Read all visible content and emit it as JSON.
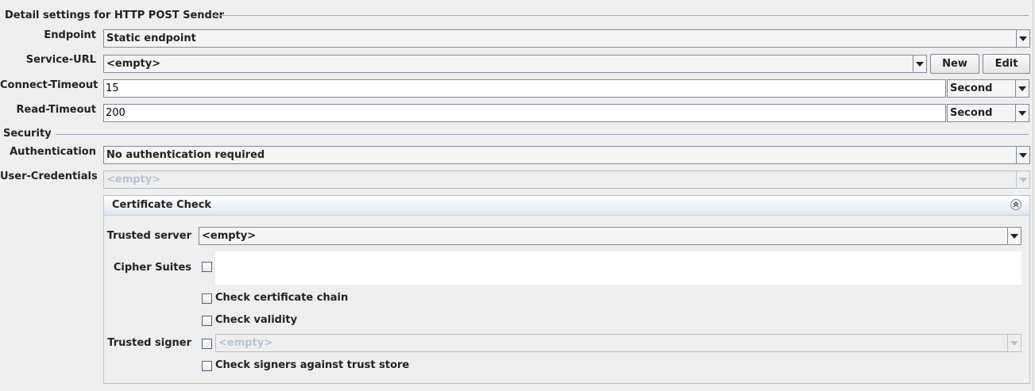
{
  "detail_section": {
    "title": "Detail settings for HTTP POST Sender",
    "endpoint": {
      "label": "Endpoint",
      "value": "Static endpoint"
    },
    "service_url": {
      "label": "Service-URL",
      "value": "<empty>",
      "new_label": "New",
      "edit_label": "Edit"
    },
    "connect_timeout": {
      "label": "Connect-Timeout",
      "value": "15",
      "unit": "Second"
    },
    "read_timeout": {
      "label": "Read-Timeout",
      "value": "200",
      "unit": "Second"
    }
  },
  "security_section": {
    "title": "Security",
    "authentication": {
      "label": "Authentication",
      "value": "No authentication required"
    },
    "user_credentials": {
      "label": "User-Credentials",
      "value": "<empty>"
    }
  },
  "certificate_check": {
    "title": "Certificate Check",
    "trusted_server": {
      "label": "Trusted server",
      "value": "<empty>"
    },
    "cipher_suites": {
      "label": "Cipher Suites"
    },
    "check_chain": {
      "label": "Check certificate chain"
    },
    "check_validity": {
      "label": "Check validity"
    },
    "trusted_signer": {
      "label": "Trusted signer",
      "value": "<empty>"
    },
    "check_signers": {
      "label": "Check signers against trust store"
    }
  },
  "colors": {
    "line": "#9aa7bd",
    "panel_border": "#b6c1d2",
    "disabled_text": "#b7c4d5"
  },
  "icons": {
    "combo_arrow": "triangle-down",
    "collapse": "double-chevron-up"
  }
}
